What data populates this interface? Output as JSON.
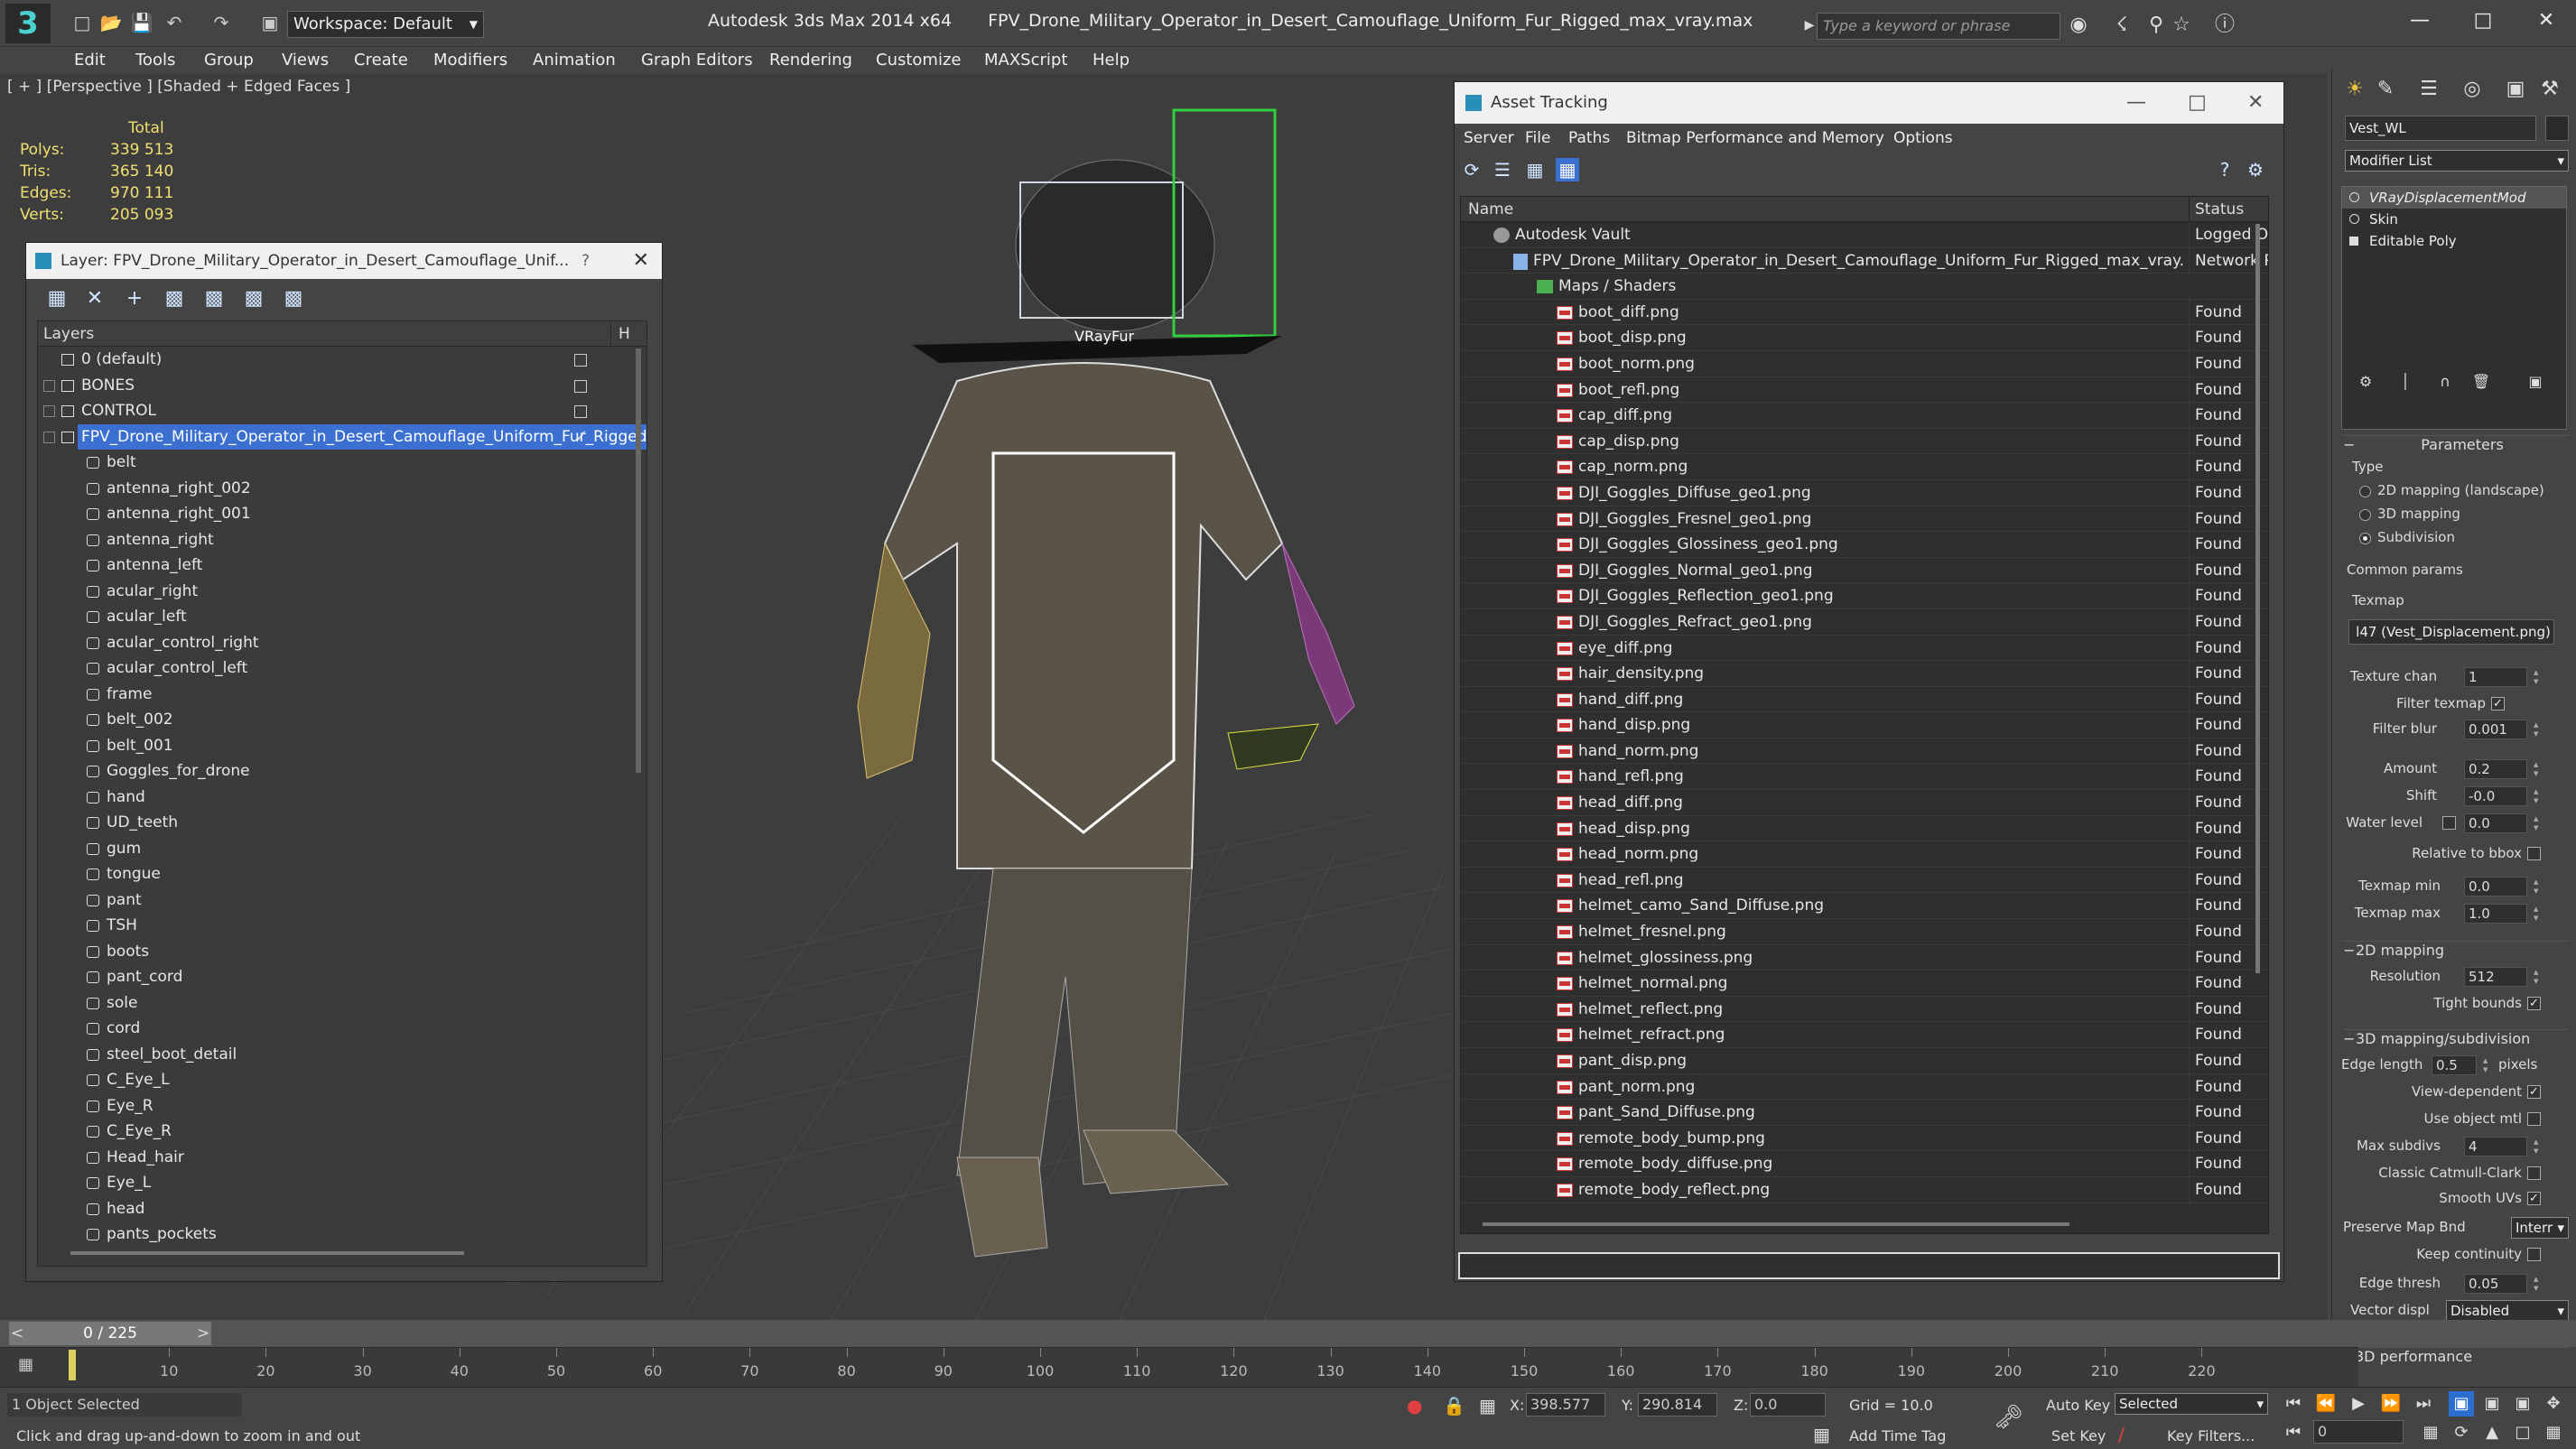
{
  "titlebar": {
    "workspace": "Workspace: Default",
    "app_name": "Autodesk 3ds Max  2014 x64",
    "file_name": "FPV_Drone_Military_Operator_in_Desert_Camouflage_Uniform_Fur_Rigged_max_vray.max",
    "search_placeholder": "Type a keyword or phrase"
  },
  "menubar": {
    "items": [
      "Edit",
      "Tools",
      "Group",
      "Views",
      "Create",
      "Modifiers",
      "Animation",
      "Graph Editors",
      "Rendering",
      "Customize",
      "MAXScript",
      "Help"
    ]
  },
  "viewport": {
    "label": "[ + ] [Perspective ] [Shaded + Edged Faces ]",
    "stats": {
      "header": "Total",
      "rows": [
        {
          "label": "Polys:",
          "value": "339 513"
        },
        {
          "label": "Tris:",
          "value": "365 140"
        },
        {
          "label": "Edges:",
          "value": "970 111"
        },
        {
          "label": "Verts:",
          "value": "205 093"
        }
      ]
    },
    "scene_label": "VRayFur"
  },
  "layer_dialog": {
    "title": "Layer: FPV_Drone_Military_Operator_in_Desert_Camouflage_Unif...",
    "help": "?",
    "close": "✕",
    "col_layers": "Layers",
    "col_h": "H",
    "top_layers": [
      {
        "label": "0 (default)"
      },
      {
        "label": "BONES"
      },
      {
        "label": "CONTROL"
      },
      {
        "label": "FPV_Drone_Military_Operator_in_Desert_Camouflage_Uniform_Fur_Rigged"
      }
    ],
    "objects": [
      "belt",
      "antenna_right_002",
      "antenna_right_001",
      "antenna_right",
      "antenna_left",
      "acular_right",
      "acular_left",
      "acular_control_right",
      "acular_control_left",
      "frame",
      "belt_002",
      "belt_001",
      "Goggles_for_drone",
      "hand",
      "UD_teeth",
      "gum",
      "tongue",
      "pant",
      "TSH",
      "boots",
      "pant_cord",
      "sole",
      "cord",
      "steel_boot_detail",
      "C_Eye_L",
      "Eye_R",
      "C_Eye_R",
      "Head_hair",
      "Eye_L",
      "head",
      "pants_pockets"
    ]
  },
  "asset_dialog": {
    "title": "Asset Tracking",
    "menu": [
      "Server",
      "File",
      "Paths",
      "Bitmap Performance and Memory",
      "Options"
    ],
    "col_name": "Name",
    "col_status": "Status",
    "vault": {
      "name": "Autodesk Vault",
      "status": "Logged Out"
    },
    "file": {
      "name": "FPV_Drone_Military_Operator_in_Desert_Camouflage_Uniform_Fur_Rigged_max_vray.max",
      "status": "Network Path"
    },
    "maps_folder": "Maps / Shaders",
    "found": "Found",
    "maps": [
      "boot_diff.png",
      "boot_disp.png",
      "boot_norm.png",
      "boot_refl.png",
      "cap_diff.png",
      "cap_disp.png",
      "cap_norm.png",
      "DJI_Goggles_Diffuse_geo1.png",
      "DJI_Goggles_Fresnel_geo1.png",
      "DJI_Goggles_Glossiness_geo1.png",
      "DJI_Goggles_Normal_geo1.png",
      "DJI_Goggles_Reflection_geo1.png",
      "DJI_Goggles_Refract_geo1.png",
      "eye_diff.png",
      "hair_density.png",
      "hand_diff.png",
      "hand_disp.png",
      "hand_norm.png",
      "hand_refl.png",
      "head_diff.png",
      "head_disp.png",
      "head_norm.png",
      "head_refl.png",
      "helmet_camo_Sand_Diffuse.png",
      "helmet_fresnel.png",
      "helmet_glossiness.png",
      "helmet_normal.png",
      "helmet_reflect.png",
      "helmet_refract.png",
      "pant_disp.png",
      "pant_norm.png",
      "pant_Sand_Diffuse.png",
      "remote_body_bump.png",
      "remote_body_diffuse.png",
      "remote_body_reflect.png"
    ]
  },
  "command_panel": {
    "object_name": "Vest_WL",
    "modifier_list": "Modifier List",
    "stack": [
      "VRayDisplacementMod",
      "Skin",
      "Editable Poly"
    ],
    "parameters": "Parameters",
    "type_label": "Type",
    "type_options": [
      "2D mapping (landscape)",
      "3D mapping",
      "Subdivision"
    ],
    "common_params": "Common params",
    "texmap_label": "Texmap",
    "texmap_value": "l47 (Vest_Displacement.png)",
    "texture_chan": {
      "label": "Texture chan",
      "value": "1"
    },
    "filter_texmap": "Filter texmap",
    "filter_blur": {
      "label": "Filter blur",
      "value": "0.001"
    },
    "amount": {
      "label": "Amount",
      "value": "0.2"
    },
    "shift": {
      "label": "Shift",
      "value": "-0.0"
    },
    "water_level": {
      "label": "Water level",
      "value": "0.0"
    },
    "relative_bbox": "Relative to bbox",
    "texmap_min": {
      "label": "Texmap min",
      "value": "0.0"
    },
    "texmap_max": {
      "label": "Texmap max",
      "value": "1.0"
    },
    "mapping_2d": "2D mapping",
    "resolution": {
      "label": "Resolution",
      "value": "512"
    },
    "tight_bounds": "Tight bounds",
    "mapping_3d": "3D mapping/subdivision",
    "edge_length": {
      "label": "Edge length",
      "value": "0.5",
      "unit": "pixels"
    },
    "view_dependent": "View-dependent",
    "use_object_mtl": "Use object mtl",
    "max_subdivs": {
      "label": "Max subdivs",
      "value": "4"
    },
    "classic_catmull": "Classic Catmull-Clark",
    "smooth_uvs": "Smooth UVs",
    "preserve_map": {
      "label": "Preserve Map Bnd",
      "value": "Interr"
    },
    "keep_continuity": "Keep continuity",
    "edge_thresh": {
      "label": "Edge thresh",
      "value": "0.05"
    },
    "vector_displ": {
      "label": "Vector displ",
      "value": "Disabled"
    },
    "performance_3d": "3D performance"
  },
  "timeline": {
    "frame": "0 / 225",
    "ticks": [
      "10",
      "20",
      "30",
      "40",
      "50",
      "60",
      "70",
      "80",
      "90",
      "100",
      "110",
      "120",
      "130",
      "140",
      "150",
      "160",
      "170",
      "180",
      "190",
      "200",
      "210",
      "220"
    ]
  },
  "statusbar": {
    "selection": "1 Object Selected",
    "prompt": "Click and drag up-and-down to zoom in and out",
    "x_label": "X:",
    "x_value": "398.577",
    "y_label": "Y:",
    "y_value": "290.814",
    "z_label": "Z:",
    "z_value": "0.0",
    "grid": "Grid = 10.0",
    "add_time_tag": "Add Time Tag",
    "auto_key": "Auto Key",
    "set_key": "Set Key",
    "selected": "Selected",
    "key_filters": "Key Filters...",
    "frame_value": "0"
  }
}
